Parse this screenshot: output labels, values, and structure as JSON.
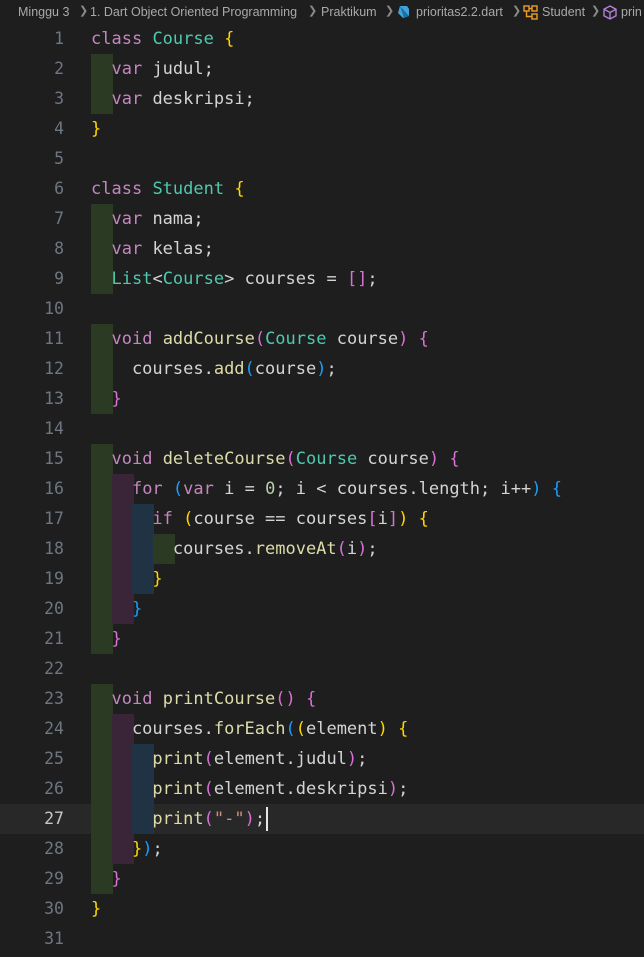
{
  "breadcrumb": {
    "items": [
      "Minggu 3",
      "1. Dart Object Oriented Programming",
      "Praktikum",
      "prioritas2.2.dart",
      "Student",
      "printCourse"
    ],
    "visible_last": "prin"
  },
  "editor": {
    "active_line": 27,
    "line_numbers": [
      "1",
      "2",
      "3",
      "4",
      "5",
      "6",
      "7",
      "8",
      "9",
      "10",
      "11",
      "12",
      "13",
      "14",
      "15",
      "16",
      "17",
      "18",
      "19",
      "20",
      "21",
      "22",
      "23",
      "24",
      "25",
      "26",
      "27",
      "28",
      "29",
      "30",
      "31"
    ],
    "lines": [
      [
        [
          "kw",
          "class"
        ],
        [
          "p",
          " "
        ],
        [
          "type",
          "Course"
        ],
        [
          "p",
          " "
        ],
        [
          "b1",
          "{"
        ]
      ],
      [
        [
          "p",
          "  "
        ],
        [
          "kw",
          "var"
        ],
        [
          "p",
          " judul;"
        ]
      ],
      [
        [
          "p",
          "  "
        ],
        [
          "kw",
          "var"
        ],
        [
          "p",
          " deskripsi;"
        ]
      ],
      [
        [
          "b1",
          "}"
        ]
      ],
      [],
      [
        [
          "kw",
          "class"
        ],
        [
          "p",
          " "
        ],
        [
          "type",
          "Student"
        ],
        [
          "p",
          " "
        ],
        [
          "b1",
          "{"
        ]
      ],
      [
        [
          "p",
          "  "
        ],
        [
          "kw",
          "var"
        ],
        [
          "p",
          " nama;"
        ]
      ],
      [
        [
          "p",
          "  "
        ],
        [
          "kw",
          "var"
        ],
        [
          "p",
          " kelas;"
        ]
      ],
      [
        [
          "p",
          "  "
        ],
        [
          "type",
          "List"
        ],
        [
          "p",
          "<"
        ],
        [
          "type",
          "Course"
        ],
        [
          "p",
          "> courses = "
        ],
        [
          "b2",
          "[]"
        ],
        [
          "p",
          ";"
        ]
      ],
      [],
      [
        [
          "p",
          "  "
        ],
        [
          "kw",
          "void"
        ],
        [
          "p",
          " "
        ],
        [
          "fn",
          "addCourse"
        ],
        [
          "b2",
          "("
        ],
        [
          "type",
          "Course"
        ],
        [
          "p",
          " course"
        ],
        [
          "b2",
          ")"
        ],
        [
          "p",
          " "
        ],
        [
          "b2",
          "{"
        ]
      ],
      [
        [
          "p",
          "    courses."
        ],
        [
          "fn",
          "add"
        ],
        [
          "b3",
          "("
        ],
        [
          "p",
          "course"
        ],
        [
          "b3",
          ")"
        ],
        [
          "p",
          ";"
        ]
      ],
      [
        [
          "p",
          "  "
        ],
        [
          "b2",
          "}"
        ]
      ],
      [],
      [
        [
          "p",
          "  "
        ],
        [
          "kw",
          "void"
        ],
        [
          "p",
          " "
        ],
        [
          "fn",
          "deleteCourse"
        ],
        [
          "b2",
          "("
        ],
        [
          "type",
          "Course"
        ],
        [
          "p",
          " course"
        ],
        [
          "b2",
          ")"
        ],
        [
          "p",
          " "
        ],
        [
          "b2",
          "{"
        ]
      ],
      [
        [
          "p",
          "    "
        ],
        [
          "kw2",
          "for"
        ],
        [
          "p",
          " "
        ],
        [
          "b3",
          "("
        ],
        [
          "kw",
          "var"
        ],
        [
          "p",
          " i = "
        ],
        [
          "num",
          "0"
        ],
        [
          "p",
          "; i < courses.length; i++"
        ],
        [
          "b3",
          ")"
        ],
        [
          "p",
          " "
        ],
        [
          "b3",
          "{"
        ]
      ],
      [
        [
          "p",
          "      "
        ],
        [
          "kw2",
          "if"
        ],
        [
          "p",
          " "
        ],
        [
          "b1",
          "("
        ],
        [
          "p",
          "course == courses"
        ],
        [
          "b2",
          "["
        ],
        [
          "p",
          "i"
        ],
        [
          "b2",
          "]"
        ],
        [
          "b1",
          ")"
        ],
        [
          "p",
          " "
        ],
        [
          "b1",
          "{"
        ]
      ],
      [
        [
          "p",
          "        courses."
        ],
        [
          "fn",
          "removeAt"
        ],
        [
          "b2",
          "("
        ],
        [
          "p",
          "i"
        ],
        [
          "b2",
          ")"
        ],
        [
          "p",
          ";"
        ]
      ],
      [
        [
          "p",
          "      "
        ],
        [
          "b1",
          "}"
        ]
      ],
      [
        [
          "p",
          "    "
        ],
        [
          "b3",
          "}"
        ]
      ],
      [
        [
          "p",
          "  "
        ],
        [
          "b2",
          "}"
        ]
      ],
      [],
      [
        [
          "p",
          "  "
        ],
        [
          "kw",
          "void"
        ],
        [
          "p",
          " "
        ],
        [
          "fn",
          "printCourse"
        ],
        [
          "b2",
          "()"
        ],
        [
          "p",
          " "
        ],
        [
          "b2",
          "{"
        ]
      ],
      [
        [
          "p",
          "    courses."
        ],
        [
          "fn",
          "forEach"
        ],
        [
          "b3",
          "("
        ],
        [
          "b1",
          "("
        ],
        [
          "p",
          "element"
        ],
        [
          "b1",
          ")"
        ],
        [
          "p",
          " "
        ],
        [
          "b1",
          "{"
        ]
      ],
      [
        [
          "p",
          "      "
        ],
        [
          "fn",
          "print"
        ],
        [
          "b2",
          "("
        ],
        [
          "p",
          "element.judul"
        ],
        [
          "b2",
          ")"
        ],
        [
          "p",
          ";"
        ]
      ],
      [
        [
          "p",
          "      "
        ],
        [
          "fn",
          "print"
        ],
        [
          "b2",
          "("
        ],
        [
          "p",
          "element.deskripsi"
        ],
        [
          "b2",
          ")"
        ],
        [
          "p",
          ";"
        ]
      ],
      [
        [
          "p",
          "      "
        ],
        [
          "fn",
          "print"
        ],
        [
          "b2",
          "("
        ],
        [
          "str",
          "\"-\""
        ],
        [
          "b2",
          ")"
        ],
        [
          "p",
          ";"
        ]
      ],
      [
        [
          "p",
          "    "
        ],
        [
          "b1",
          "}"
        ],
        [
          "b3",
          ")"
        ],
        [
          "p",
          ";"
        ]
      ],
      [
        [
          "p",
          "  "
        ],
        [
          "b2",
          "}"
        ]
      ],
      [
        [
          "b1",
          "}"
        ]
      ],
      []
    ]
  },
  "colors": {
    "background": "#1e1e1e",
    "current_line": "#282828",
    "indent_guide_1": "#2b3a23",
    "indent_guide_2": "#3a2438",
    "indent_guide_3": "#1f3345"
  }
}
